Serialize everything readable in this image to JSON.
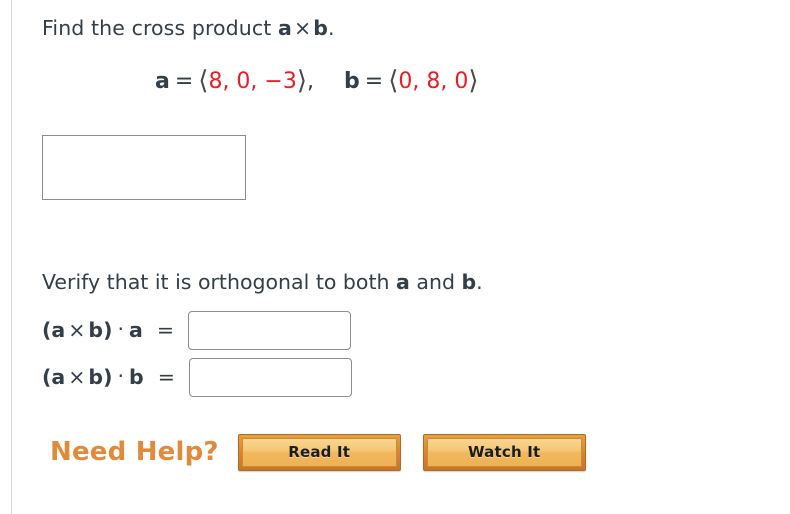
{
  "problem": {
    "prompt": {
      "lead": "Find the cross product ",
      "vec_a": "a",
      "cross_symbol": "×",
      "vec_b": "b",
      "period": "."
    },
    "givens": {
      "a_label": "a",
      "a_equals": "=",
      "a_open": "⟨",
      "a_components": "8, 0, −3",
      "a_close": "⟩",
      "a_trailing_comma": ",",
      "b_label": "b",
      "b_equals": "=",
      "b_open": "⟨",
      "b_components": "0, 8, 0",
      "b_close": "⟩"
    },
    "answer_field": {
      "value": "",
      "placeholder": ""
    },
    "verify": {
      "lead": "Verify that it is orthogonal to both ",
      "vec_a": "a",
      "conjunction": " and ",
      "vec_b": "b",
      "period": "."
    },
    "dot_products": [
      {
        "open_paren": "(",
        "vec_a": "a",
        "cross_symbol": "×",
        "vec_b": "b",
        "close_paren": ")",
        "dot_symbol": "·",
        "operand": "a",
        "equals": "=",
        "value": "",
        "placeholder": ""
      },
      {
        "open_paren": "(",
        "vec_a": "a",
        "cross_symbol": "×",
        "vec_b": "b",
        "close_paren": ")",
        "dot_symbol": "·",
        "operand": "b",
        "equals": "=",
        "value": "",
        "placeholder": ""
      }
    ]
  },
  "help": {
    "label": "Need Help?",
    "buttons": [
      {
        "label": "Read It"
      },
      {
        "label": "Watch It"
      }
    ]
  },
  "colors": {
    "text": "#333e48",
    "vector_values": "#ed1c24",
    "need_help": "#e08a3c",
    "button_border": "#b56a24",
    "button_face": "#f5c774",
    "input_border": "#8d8d8d",
    "left_rule": "#d8d8d8"
  }
}
